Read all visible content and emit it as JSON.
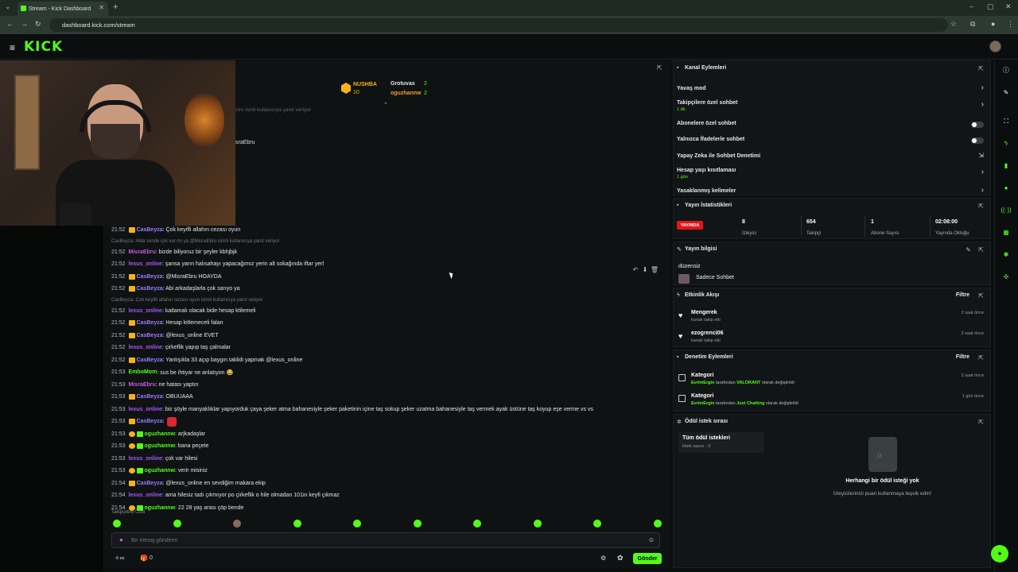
{
  "browser": {
    "tab_title": "Stream - Kick Dashboard",
    "url": "dashboard.kick.com/stream"
  },
  "header": {
    "logo": "KICK"
  },
  "leaderboard": {
    "top_user": "NUSHBA",
    "top_value": "10",
    "user2": "Grotuvas",
    "user2_value": "2",
    "user3": "oguzhannw",
    "user3_value": "2"
  },
  "chat_fragments": {
    "reply_fragment": "sını ismli kullanıcıya yanıt veriyor",
    "name_fragment": "sraEbru"
  },
  "chat": [
    {
      "time": "21:52",
      "badge": "sub",
      "user": "CasBeyza",
      "color": "#9b7bff",
      "text": ": Çok keyifli allahın cezası oyun"
    },
    {
      "reply": "CasBeyza: Abla sende içki var mı ya @MisraEbru isimli kullanıcıya yanıt veriyor"
    },
    {
      "time": "21:52",
      "badge": "",
      "user": "MisraEbru",
      "color": "#c45ce0",
      "text": ": bizde biliyoruz bir şeyler kbhjbjk"
    },
    {
      "time": "21:52",
      "badge": "",
      "user": "lexus_online",
      "color": "#a855f7",
      "text": ": şansa yarın halısahayı yapacağımız yerin alt sokağında iftar yerl"
    },
    {
      "time": "21:52",
      "badge": "sub",
      "user": "CasBeyza",
      "color": "#9b7bff",
      "text": ": @MisraEbru HOAYDA"
    },
    {
      "time": "21:52",
      "badge": "sub",
      "user": "CasBeyza",
      "color": "#9b7bff",
      "text": ": Abi arkadaşlarla çok sarıyo ya"
    },
    {
      "reply": "CasBeyza: Çok keyifli allahın cezası oyun isimli kullanıcıya yanıt veriyor"
    },
    {
      "time": "21:52",
      "badge": "",
      "user": "lexus_online",
      "color": "#a855f7",
      "text": ": katlamalı olacak bide hesap ktilemeli"
    },
    {
      "time": "21:52",
      "badge": "sub",
      "user": "CasBeyza",
      "color": "#9b7bff",
      "text": ": Hesap kitlemeceli falan"
    },
    {
      "time": "21:52",
      "badge": "sub",
      "user": "CasBeyza",
      "color": "#9b7bff",
      "text": ": @lexus_online EVET"
    },
    {
      "time": "21:52",
      "badge": "",
      "user": "lexus_online",
      "color": "#a855f7",
      "text": ": çirkeflik yapıp taş çalmalar"
    },
    {
      "time": "21:52",
      "badge": "sub",
      "user": "CasBeyza",
      "color": "#9b7bff",
      "text": ": Yanlışıkla 33 açıp baygın taklidi yapmak @lexus_online"
    },
    {
      "time": "21:53",
      "badge": "",
      "user": "EmboMom",
      "color": "#53fc18",
      "text": ": sus be ihtiyar ne anlatıyon 😂"
    },
    {
      "time": "21:53",
      "badge": "",
      "user": "MisraEbru",
      "color": "#c45ce0",
      "text": ": ne hatası yaptın"
    },
    {
      "time": "21:53",
      "badge": "sub",
      "user": "CasBeyza",
      "color": "#9b7bff",
      "text": ": OBUUAAA"
    },
    {
      "time": "21:53",
      "badge": "",
      "user": "lexus_online",
      "color": "#a855f7",
      "text": ": biz şöyle manyaklıklar yapıyorduk çaya şeker atma bahanesiyle şeker paketinin içine taş sokup şeker uzatma bahanesiyle taş vermek ayak üstüne taş koyup eşe verme vs vs"
    },
    {
      "time": "21:53",
      "badge": "sub",
      "user": "CasBeyza",
      "color": "#9b7bff",
      "text": ":"
    },
    {
      "time": "21:53",
      "badge": "both",
      "user": "oguzhannw",
      "color": "#53fc18",
      "text": ": arjkadaşlar"
    },
    {
      "time": "21:53",
      "badge": "both",
      "user": "oguzhannw",
      "color": "#53fc18",
      "text": ": bana peçete"
    },
    {
      "time": "21:53",
      "badge": "",
      "user": "lexus_online",
      "color": "#a855f7",
      "text": ": çok var hilesi"
    },
    {
      "time": "21:53",
      "badge": "both",
      "user": "oguzhannw",
      "color": "#53fc18",
      "text": ": verir misiniz"
    },
    {
      "time": "21:54",
      "badge": "sub",
      "user": "CasBeyza",
      "color": "#9b7bff",
      "text": ": @lexus_online en sevdiğim makara ekip"
    },
    {
      "time": "21:54",
      "badge": "",
      "user": "lexus_online",
      "color": "#a855f7",
      "text": ": ama hilesiz tadı çıkmıyor po çirkeflik o hile olmadan 101in keyfi çıkmaz"
    },
    {
      "time": "21:54",
      "badge": "both",
      "user": "oguzhannw",
      "color": "#53fc18",
      "text": ": 22 28 yaş arası çöp bende"
    }
  ],
  "emotes_label": "Takipçilere Özel",
  "input": {
    "placeholder": "Bir mesaj gönderin"
  },
  "chat_bottom": {
    "points": "0",
    "send": "Gönder"
  },
  "channel_actions": {
    "title": "Kanal Eylemleri",
    "slow_mode": "Yavaş mod",
    "followers_only": "Takipçilere özel sohbet",
    "followers_only_sub": "1 dk.",
    "subs_only": "Abonelere özel sohbet",
    "emotes_only": "Yalnızca İfadelerle sohbet",
    "ai_moderation": "Yapay Zeka ile Sohbet Denetimi",
    "account_age": "Hesap yaşı kısıtlaması",
    "account_age_sub": "1 gün",
    "banned_words": "Yasaklanmış kelimeler"
  },
  "stream_stats": {
    "title": "Yayın İstatistikleri",
    "live": "YAYINDA",
    "viewers": "8",
    "viewers_label": "İzleyici",
    "followers": "654",
    "followers_label": "Takipçi",
    "subs": "1",
    "subs_label": "Abone Sayısı",
    "uptime": "02:08:00",
    "uptime_label": "Yayında Olduğu"
  },
  "stream_info": {
    "title": "Yayın bilgisi",
    "stream_title": "düzensiz",
    "category": "Sadece Sohbet"
  },
  "activity": {
    "title": "Etkinlik Akışı",
    "filter": "Filtre",
    "events": [
      {
        "name": "Mengerek",
        "sub": "kanalı takip etti",
        "time": "2 saat önce"
      },
      {
        "name": "ezogrenci06",
        "sub": "kanalı takip etti",
        "time": "2 saat önce"
      }
    ]
  },
  "moderation": {
    "title": "Denetim Eylemleri",
    "filter": "Filtre",
    "items": [
      {
        "name": "Kategori",
        "user": "EvrimErgin",
        "mid": " tarafından ",
        "value": "VALORANT",
        "end": " olarak değiştirildi",
        "time": "2 saat önce"
      },
      {
        "name": "Kategori",
        "user": "EvrimErgin",
        "mid": " tarafından ",
        "value": "Just Chatting",
        "end": " olarak değiştirildi",
        "time": "1 gün önce"
      }
    ]
  },
  "rewards": {
    "title": "Ödül istek sırası",
    "tab": "Tüm ödül istekleri",
    "tab_sub": "İstek sayısı - 0",
    "empty_title": "Herhangi bir ödül isteği yok",
    "empty_sub": "İzleyicilerinizi puan kullanmaya teşvik edin!"
  }
}
